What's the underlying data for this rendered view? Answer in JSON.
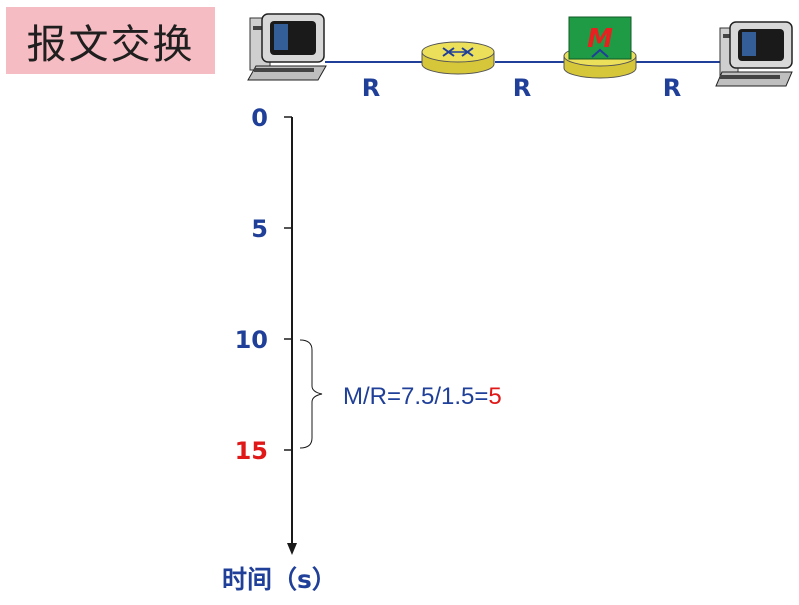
{
  "title": "报文交换",
  "topology": {
    "link_labels": [
      "R",
      "R",
      "R"
    ],
    "message_label": "M",
    "colors": {
      "router": "#e8d84a",
      "message_box": "#1f9a45",
      "message_text": "#e82020",
      "link": "#1f3f99"
    }
  },
  "timeline": {
    "ticks": [
      {
        "value": 0,
        "label": "0",
        "color": "#1f3f99"
      },
      {
        "value": 5,
        "label": "5",
        "color": "#1f3f99"
      },
      {
        "value": 10,
        "label": "10",
        "color": "#1f3f99"
      },
      {
        "value": 15,
        "label": "15",
        "color": "#e01818"
      }
    ],
    "axis_label": "时间（s）",
    "brace_range": [
      10,
      15
    ]
  },
  "formula": {
    "prefix": "M/R=7.5/1.5=",
    "result": "5",
    "result_color": "#e01818"
  }
}
